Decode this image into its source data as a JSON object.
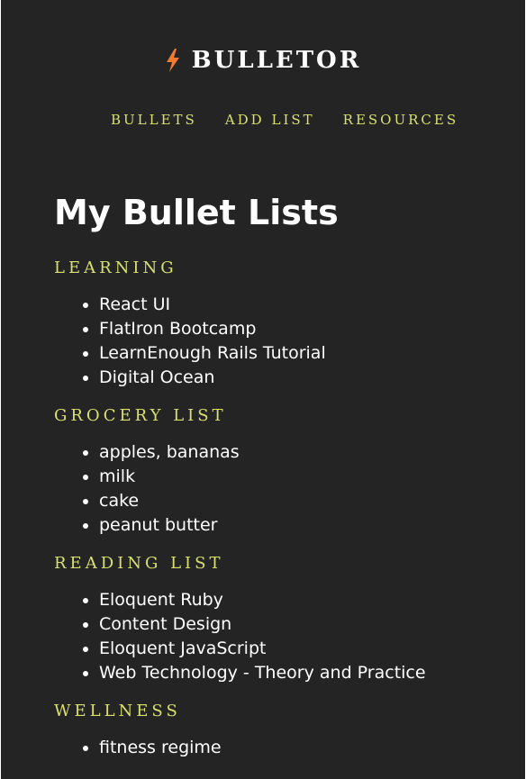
{
  "brand": {
    "name": "BULLETOR",
    "icon": "lightning-bolt-icon",
    "accent_color": "#f07a2e"
  },
  "nav": {
    "items": [
      {
        "label": "BULLETS"
      },
      {
        "label": "ADD LIST"
      },
      {
        "label": "RESOURCES"
      }
    ]
  },
  "main": {
    "title": "My Bullet Lists",
    "lists": [
      {
        "title": "LEARNING",
        "items": [
          "React UI",
          "FlatIron Bootcamp",
          "LearnEnough Rails Tutorial",
          "Digital Ocean"
        ]
      },
      {
        "title": "GROCERY LIST",
        "items": [
          "apples, bananas",
          "milk",
          "cake",
          "peanut butter"
        ]
      },
      {
        "title": "READING LIST",
        "items": [
          "Eloquent Ruby",
          "Content Design",
          "Eloquent JavaScript",
          "Web Technology - Theory and Practice"
        ]
      },
      {
        "title": "WELLNESS",
        "items": [
          "fitness regime"
        ]
      }
    ]
  },
  "colors": {
    "background": "#242424",
    "heading_accent": "#d8e06f",
    "text": "#ffffff"
  }
}
